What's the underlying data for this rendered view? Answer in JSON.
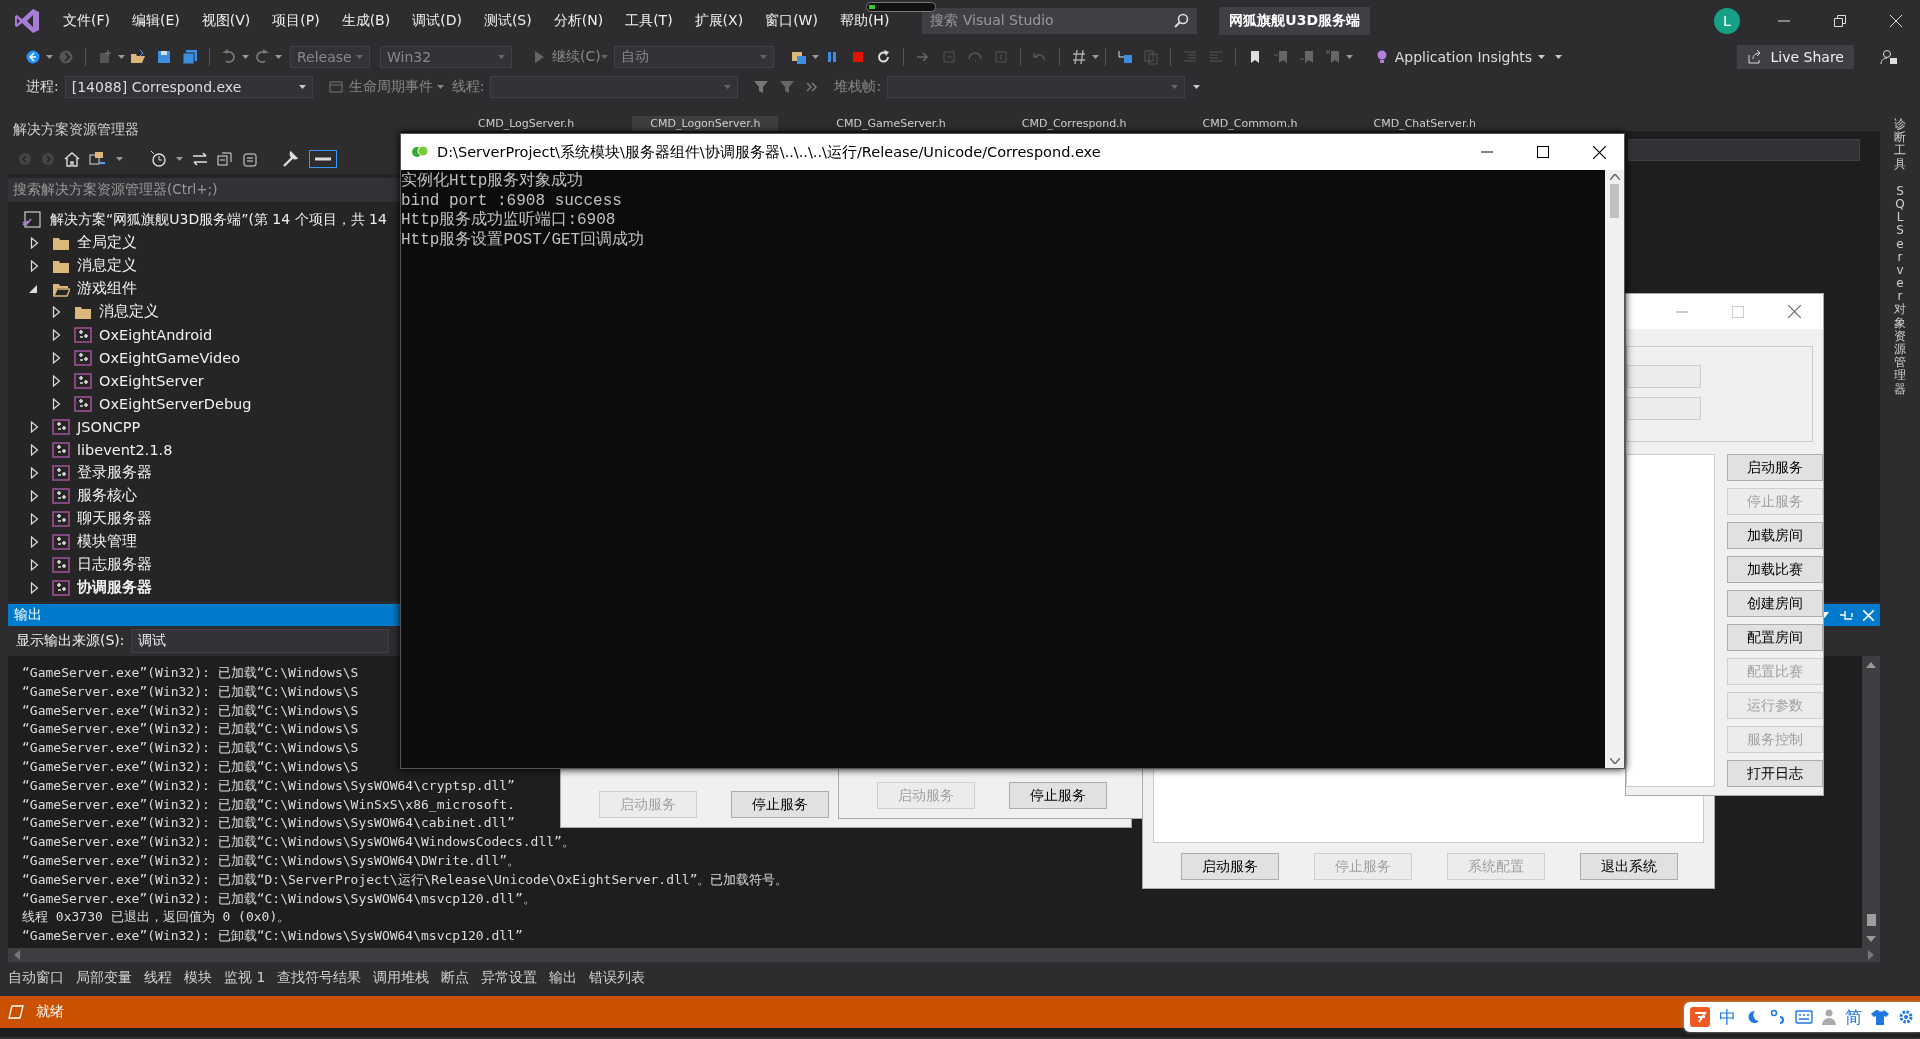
{
  "title_bar": {
    "menus": [
      "文件(F)",
      "编辑(E)",
      "视图(V)",
      "项目(P)",
      "生成(B)",
      "调试(D)",
      "测试(S)",
      "分析(N)",
      "工具(T)",
      "扩展(X)",
      "窗口(W)",
      "帮助(H)"
    ],
    "search": {
      "placeholder": "搜索 Visual Studio"
    },
    "solution_name": "网狐旗舰U3D服务端",
    "account_initial": "L"
  },
  "toolbar": {
    "configuration": "Release",
    "platform": "Win32",
    "continue": "继续(C)",
    "debug_target": "自动",
    "insights": "Application Insights",
    "live_share": "Live Share"
  },
  "debug_location": {
    "process_label": "进程:",
    "process": "[14088] Correspond.exe",
    "lifecycle": "生命周期事件",
    "thread_label": "线程:",
    "stack_label": "堆栈帧:"
  },
  "solution_explorer": {
    "title": "解决方案资源管理器",
    "search": {
      "placeholder": "搜索解决方案资源管理器(Ctrl+;)"
    },
    "solution": "解决方案“网狐旗舰U3D服务端”(第 14 个项目，共 14",
    "items": [
      {
        "label": "全局定义",
        "kind": "folder",
        "expanded": false,
        "startup": false
      },
      {
        "label": "消息定义",
        "kind": "folder",
        "expanded": false,
        "startup": false
      },
      {
        "label": "游戏组件",
        "kind": "folder",
        "expanded": true,
        "startup": false,
        "children": [
          {
            "label": "消息定义",
            "kind": "folder",
            "expanded": false,
            "startup": false
          },
          {
            "label": "OxEightAndroid",
            "kind": "project",
            "expanded": false,
            "startup": false
          },
          {
            "label": "OxEightGameVideo",
            "kind": "project",
            "expanded": false,
            "startup": false
          },
          {
            "label": "OxEightServer",
            "kind": "project",
            "expanded": false,
            "startup": false
          },
          {
            "label": "OxEightServerDebug",
            "kind": "project",
            "expanded": false,
            "startup": false
          }
        ]
      },
      {
        "label": "JSONCPP",
        "kind": "project",
        "expanded": false,
        "startup": false
      },
      {
        "label": "libevent2.1.8",
        "kind": "project",
        "expanded": false,
        "startup": false
      },
      {
        "label": "登录服务器",
        "kind": "project",
        "expanded": false,
        "startup": false
      },
      {
        "label": "服务核心",
        "kind": "project",
        "expanded": false,
        "startup": false
      },
      {
        "label": "聊天服务器",
        "kind": "project",
        "expanded": false,
        "startup": false
      },
      {
        "label": "模块管理",
        "kind": "project",
        "expanded": false,
        "startup": false
      },
      {
        "label": "日志服务器",
        "kind": "project",
        "expanded": false,
        "startup": false
      },
      {
        "label": "协调服务器",
        "kind": "project",
        "expanded": false,
        "startup": true
      }
    ]
  },
  "editor_tabs": [
    {
      "label": "CMD_LogServer.h",
      "selected": false
    },
    {
      "label": "CMD_LogonServer.h",
      "selected": true
    },
    {
      "label": "CMD_GameServer.h",
      "selected": false
    },
    {
      "label": "CMD_Correspond.h",
      "selected": false
    },
    {
      "label": "CMD_Commom.h",
      "selected": false
    },
    {
      "label": "CMD_ChatServer.h",
      "selected": false
    }
  ],
  "side_panels": [
    "诊断工具",
    "SQL Server 对象资源管理器"
  ],
  "output": {
    "title": "输出",
    "source_label": "显示输出来源(S):",
    "source": "调试",
    "lines": [
      "“GameServer.exe”(Win32): 已加载“C:\\Windows\\S",
      "“GameServer.exe”(Win32): 已加载“C:\\Windows\\S",
      "“GameServer.exe”(Win32): 已加载“C:\\Windows\\S",
      "“GameServer.exe”(Win32): 已加载“C:\\Windows\\S",
      "“GameServer.exe”(Win32): 已加载“C:\\Windows\\S",
      "“GameServer.exe”(Win32): 已加载“C:\\Windows\\S",
      "“GameServer.exe”(Win32): 已加载“C:\\Windows\\SysWOW64\\cryptsp.dll”",
      "“GameServer.exe”(Win32): 已加载“C:\\Windows\\WinSxS\\x86_microsoft.",
      "“GameServer.exe”(Win32): 已加载“C:\\Windows\\SysWOW64\\cabinet.dll”",
      "“GameServer.exe”(Win32): 已加载“C:\\Windows\\SysWOW64\\WindowsCodecs.dll”。",
      "“GameServer.exe”(Win32): 已加载“C:\\Windows\\SysWOW64\\DWrite.dll”。",
      "“GameServer.exe”(Win32): 已加载“D:\\ServerProject\\运行\\Release\\Unicode\\OxEightServer.dll”。已加载符号。",
      "“GameServer.exe”(Win32): 已加载“C:\\Windows\\SysWOW64\\msvcp120.dll”。",
      "线程 0x3730 已退出，返回值为 0 (0x0)。",
      "“GameServer.exe”(Win32): 已卸载“C:\\Windows\\SysWOW64\\msvcp120.dll”"
    ]
  },
  "bottom_tabs": [
    "自动窗口",
    "局部变量",
    "线程",
    "模块",
    "监视 1",
    "查找符号结果",
    "调用堆栈",
    "断点",
    "异常设置",
    "输出",
    "错误列表"
  ],
  "status_bar": {
    "text": "就绪"
  },
  "ime_bar": {
    "mode": "中",
    "script": "简"
  },
  "console": {
    "title": "D:\\ServerProject\\系统模块\\服务器组件\\协调服务器\\..\\..\\..\\运行/Release/Unicode/Correspond.exe",
    "lines": [
      "实例化Http服务对象成功",
      "bind port :6908 success",
      "Http服务成功监听端口:6908",
      "Http服务设置POST/GET回调成功"
    ]
  },
  "service_dialogs": [
    {
      "buttons": [
        {
          "label": "启动服务",
          "disabled": true
        },
        {
          "label": "停止服务",
          "disabled": false
        }
      ]
    },
    {
      "buttons": [
        {
          "label": "启动服务",
          "disabled": true
        },
        {
          "label": "停止服务",
          "disabled": false
        }
      ]
    }
  ],
  "control_dialog": {
    "buttons": [
      {
        "label": "启动服务",
        "disabled": false
      },
      {
        "label": "停止服务",
        "disabled": true
      },
      {
        "label": "加载房间",
        "disabled": false
      },
      {
        "label": "加载比赛",
        "disabled": false
      },
      {
        "label": "创建房间",
        "disabled": false
      },
      {
        "label": "配置房间",
        "disabled": false
      },
      {
        "label": "配置比赛",
        "disabled": true
      },
      {
        "label": "运行参数",
        "disabled": true
      },
      {
        "label": "服务控制",
        "disabled": true
      },
      {
        "label": "打开日志",
        "disabled": false
      }
    ]
  },
  "main_dialog": {
    "buttons": [
      {
        "label": "启动服务",
        "disabled": false
      },
      {
        "label": "停止服务",
        "disabled": true
      },
      {
        "label": "系统配置",
        "disabled": true
      },
      {
        "label": "退出系统",
        "disabled": false
      }
    ]
  }
}
